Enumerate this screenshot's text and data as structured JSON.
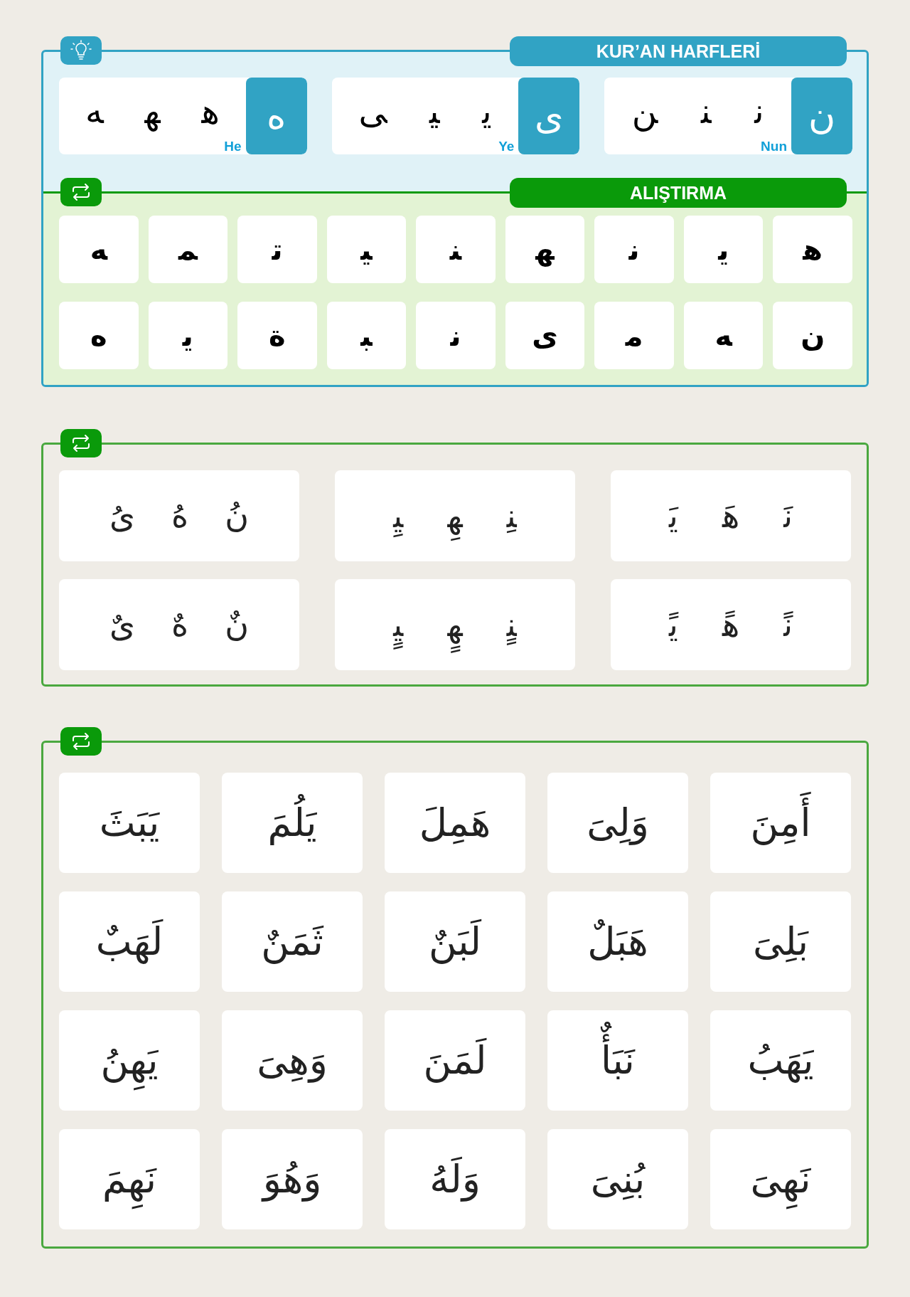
{
  "letters_panel": {
    "title": "KUR’AN HARFLERİ",
    "groups": [
      {
        "name": "Nun",
        "forms": [
          "ن",
          "ن‍",
          "‍ن‍",
          "‍ن"
        ]
      },
      {
        "name": "Ye",
        "forms": [
          "ی",
          "ی‍",
          "‍ی‍",
          "‍ی"
        ]
      },
      {
        "name": "He",
        "forms": [
          "ه",
          "ه‍",
          "‍ه‍",
          "‍ه"
        ]
      }
    ]
  },
  "exercise": {
    "title": "ALIŞTIRMA",
    "rows": [
      [
        "ه‍",
        "ی‍",
        "ن‍",
        "‍ه‍",
        "‍ن‍",
        "‍ی‍",
        "ت‍",
        "‍م‍",
        "‍ه"
      ],
      [
        "ن",
        "‍ه",
        "م‍",
        "ی",
        "ن‍",
        "‍ب‍",
        "ة",
        "ی‍",
        "ه"
      ]
    ]
  },
  "harakat_panel": {
    "cards": [
      [
        "نَ‍",
        "هَ‍",
        "یَ‍"
      ],
      [
        "‍نِ‍",
        "ﻬِ",
        "‍یِ‍"
      ],
      [
        "نُ",
        "هُ",
        "یُ"
      ],
      [
        "نً‍",
        "هً‍",
        "یً‍"
      ],
      [
        "‍نٍ‍",
        "ﻬٍ",
        "‍یٍ‍"
      ],
      [
        "نٌ",
        "هٌ",
        "یٌ"
      ]
    ]
  },
  "words_panel": {
    "words": [
      "أَمِنَ",
      "وَلِىَ",
      "هَمِلَ",
      "يَلُمَ",
      "يَبَثَ",
      "بَلِىَ",
      "هَبَلٌ",
      "لَبَنٌ",
      "ثَمَنٌ",
      "لَهَبٌ",
      "يَهَبُ",
      "نَبَأٌ",
      "لَمَنَ",
      "وَهِىَ",
      "يَهِنُ",
      "نَهِىَ",
      "بُنِىَ",
      "وَلَهُ",
      "وَهُوَ",
      "نَهِمَ"
    ]
  }
}
